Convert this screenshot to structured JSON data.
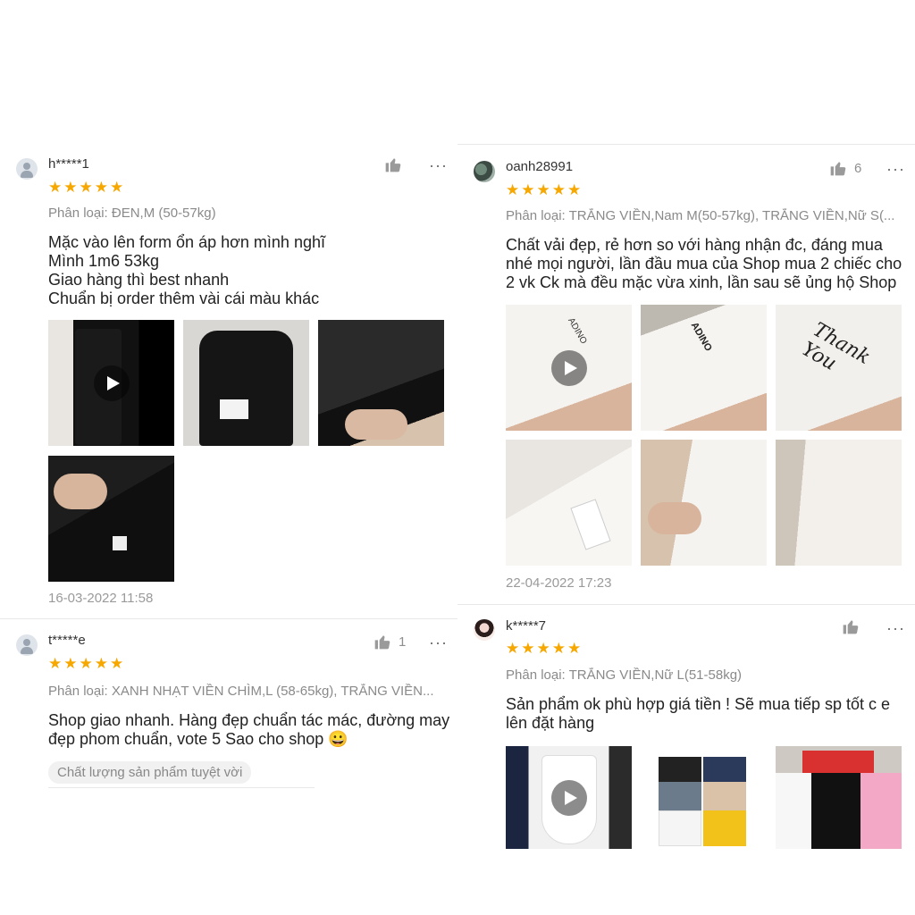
{
  "reviews": [
    {
      "username": "h*****1",
      "rating": 5,
      "likes": "",
      "variant": "Phân loại: ĐEN,M (50-57kg)",
      "comment": "Mặc vào lên form ổn áp hơn mình nghĩ\nMình 1m6 53kg\nGiao hàng thì best nhanh\nChuẩn bị order thêm vài cái màu khác",
      "date": "16-03-2022 11:58"
    },
    {
      "username": "oanh28991",
      "rating": 5,
      "likes": "6",
      "variant": "Phân loại: TRẮNG VIỀN,Nam M(50-57kg), TRẮNG VIỀN,Nữ S(...",
      "comment": "Chất vải đẹp, rẻ hơn so với hàng nhận đc, đáng mua\nnhé mọi người, lần đầu mua của Shop mua 2 chiếc cho\n2 vk Ck mà đều mặc vừa xinh, lần sau sẽ ủng hộ Shop",
      "date": "22-04-2022 17:23",
      "media_text": {
        "brand_a": "ADINO",
        "brand_b": "ADINO",
        "thank_you": "Thank You"
      }
    },
    {
      "username": "t*****e",
      "rating": 5,
      "likes": "1",
      "variant": "Phân loại: XANH NHẠT VIỀN CHÌM,L (58-65kg), TRẮNG VIỀN...",
      "comment": "Shop giao nhanh. Hàng đẹp chuẩn tác mác, đường may\nđẹp phom chuẩn, vote 5 Sao cho shop 😀",
      "tag": "Chất lượng sản phẩm tuyệt vời"
    },
    {
      "username": "k*****7",
      "rating": 5,
      "likes": "",
      "variant": "Phân loại: TRẮNG VIỀN,Nữ L(51-58kg)",
      "comment": "Sản phẩm ok phù hợp giá tiền ! Sẽ mua tiếp sp tốt c e\nlên  đặt hàng"
    }
  ],
  "icons": {
    "star": "★",
    "more": "···"
  },
  "colors": {
    "star": "#f6a700",
    "muted_text": "#8a8a8a"
  }
}
